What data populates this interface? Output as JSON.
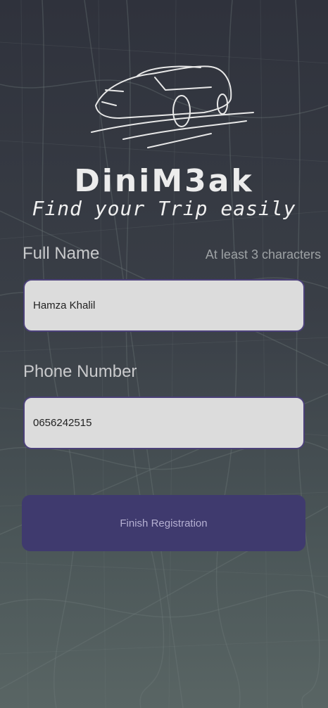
{
  "app": {
    "brand": "DiniM3ak",
    "tagline": "Find your Trip easily",
    "logo_icon": "car-icon"
  },
  "form": {
    "full_name": {
      "label": "Full Name",
      "hint": "At least 3 characters",
      "value": "Hamza Khalil"
    },
    "phone": {
      "label": "Phone Number",
      "value": "0656242515"
    },
    "submit_label": "Finish Registration"
  },
  "colors": {
    "accent": "#3f3a6e",
    "field_border": "#4b4079",
    "field_bg": "#dcdcdc"
  }
}
